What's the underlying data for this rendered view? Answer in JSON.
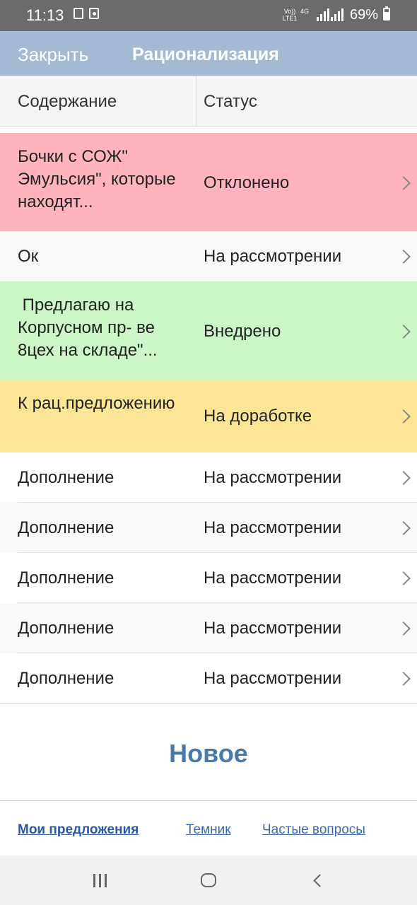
{
  "statusbar": {
    "time": "11:13",
    "net_label": "Vo)) LTE1",
    "net_type": "4G",
    "battery": "69%"
  },
  "appbar": {
    "close_label": "Закрыть",
    "title": "Рационализация"
  },
  "table": {
    "col_content": "Содержание",
    "col_status": "Статус"
  },
  "rows": [
    {
      "content": "Бочки с СОЖ\" Эмульсия\", которые находят...",
      "status": "Отклонено",
      "color": "#ffb3be"
    },
    {
      "content": "Ок",
      "status": "На рассмотрении",
      "color": "#f9f9f9"
    },
    {
      "content": " Предлагаю на Корпусном пр- ве 8цех на складе\"...",
      "status": "Внедрено",
      "color": "#ccf5c8"
    },
    {
      "content": "К рац.предложению",
      "status": "На доработке",
      "color": "#fde598"
    },
    {
      "content": "Дополнение",
      "status": "На рассмотрении",
      "color": "#ffffff"
    },
    {
      "content": "Дополнение",
      "status": "На рассмотрении",
      "color": "#f9f9f9"
    },
    {
      "content": "Дополнение",
      "status": "На рассмотрении",
      "color": "#ffffff"
    },
    {
      "content": "Дополнение",
      "status": "На рассмотрении",
      "color": "#f9f9f9"
    },
    {
      "content": "Дополнение",
      "status": "На рассмотрении",
      "color": "#ffffff"
    }
  ],
  "new_button": "Новое",
  "footer": {
    "my_proposals": "Мои предложения",
    "topics": "Темник",
    "faq": "Частые вопросы"
  },
  "icons": {
    "row_chevron": "chevron-right-icon",
    "nav_recents": "recents-icon",
    "nav_home": "home-icon",
    "nav_back": "back-icon"
  }
}
